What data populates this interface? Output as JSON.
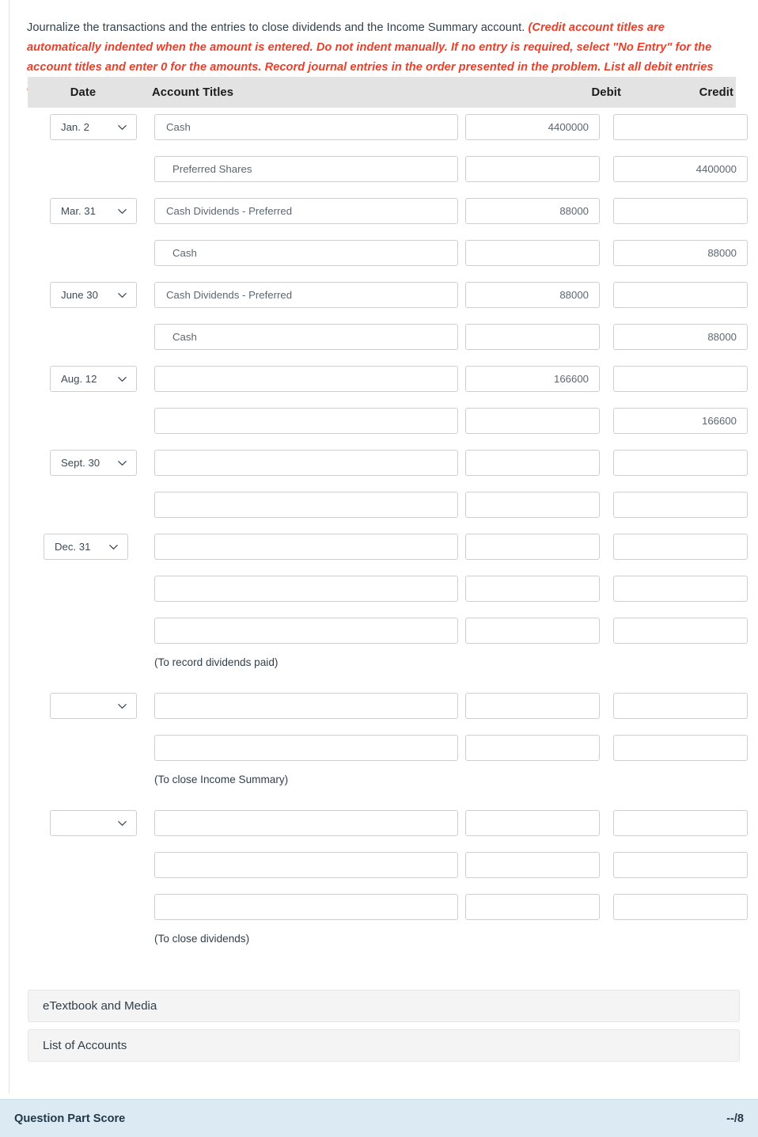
{
  "instruction": {
    "lead": "Journalize the transactions and the entries to close dividends and the Income Summary account.",
    "note": "(Credit account titles are automatically indented when the amount is entered. Do not indent manually. If no entry is required, select \"No Entry\" for the account titles and enter 0 for the amounts. Record journal entries in the order presented in the problem. List all debit entries before credit entries.)"
  },
  "table": {
    "headers": {
      "date": "Date",
      "account": "Account Titles",
      "debit": "Debit",
      "credit": "Credit"
    },
    "date_placeholder": "",
    "rows": [
      {
        "type": "entry",
        "date": "Jan. 2",
        "has_date": true,
        "account": "Cash",
        "indent": false,
        "debit": "4400000",
        "credit": ""
      },
      {
        "type": "entry",
        "date": "",
        "has_date": false,
        "account": "Preferred Shares",
        "indent": true,
        "debit": "",
        "credit": "4400000"
      },
      {
        "type": "entry",
        "date": "Mar. 31",
        "has_date": true,
        "account": "Cash Dividends - Preferred",
        "indent": false,
        "debit": "88000",
        "credit": ""
      },
      {
        "type": "entry",
        "date": "",
        "has_date": false,
        "account": "Cash",
        "indent": true,
        "debit": "",
        "credit": "88000"
      },
      {
        "type": "entry",
        "date": "June 30",
        "has_date": true,
        "account": "Cash Dividends - Preferred",
        "indent": false,
        "debit": "88000",
        "credit": ""
      },
      {
        "type": "entry",
        "date": "",
        "has_date": false,
        "account": "Cash",
        "indent": true,
        "debit": "",
        "credit": "88000"
      },
      {
        "type": "entry",
        "date": "Aug. 12",
        "has_date": true,
        "account": "",
        "indent": false,
        "debit": "166600",
        "credit": ""
      },
      {
        "type": "entry",
        "date": "",
        "has_date": false,
        "account": "",
        "indent": true,
        "debit": "",
        "credit": "166600"
      },
      {
        "type": "entry",
        "date": "Sept. 30",
        "has_date": true,
        "account": "",
        "indent": false,
        "debit": "",
        "credit": ""
      },
      {
        "type": "entry",
        "date": "",
        "has_date": false,
        "account": "",
        "indent": true,
        "debit": "",
        "credit": ""
      },
      {
        "type": "entry",
        "date": "Dec. 31",
        "has_date": true,
        "wide": true,
        "account": "",
        "indent": false,
        "debit": "",
        "credit": ""
      },
      {
        "type": "entry",
        "date": "",
        "has_date": false,
        "account": "",
        "indent": true,
        "debit": "",
        "credit": ""
      },
      {
        "type": "entry",
        "date": "",
        "has_date": false,
        "account": "",
        "indent": true,
        "debit": "",
        "credit": ""
      },
      {
        "type": "memo",
        "text": "(To record dividends paid)"
      },
      {
        "type": "entry",
        "date": "",
        "has_date": true,
        "account": "",
        "indent": false,
        "debit": "",
        "credit": ""
      },
      {
        "type": "entry",
        "date": "",
        "has_date": false,
        "account": "",
        "indent": true,
        "debit": "",
        "credit": ""
      },
      {
        "type": "memo",
        "text": "(To close Income Summary)"
      },
      {
        "type": "entry",
        "date": "",
        "has_date": true,
        "account": "",
        "indent": false,
        "debit": "",
        "credit": ""
      },
      {
        "type": "entry",
        "date": "",
        "has_date": false,
        "account": "",
        "indent": true,
        "debit": "",
        "credit": ""
      },
      {
        "type": "entry",
        "date": "",
        "has_date": false,
        "account": "",
        "indent": true,
        "debit": "",
        "credit": ""
      },
      {
        "type": "memo",
        "text": "(To close dividends)"
      }
    ]
  },
  "resources": {
    "etextbook": "eTextbook and Media",
    "accounts": "List of Accounts"
  },
  "score": {
    "label": "Question Part Score",
    "value": "--/8"
  },
  "colors": {
    "note_red": "#e8402a",
    "header_gray": "#e3e3e3",
    "score_blue": "#dcebf3",
    "text": "#31404b"
  }
}
